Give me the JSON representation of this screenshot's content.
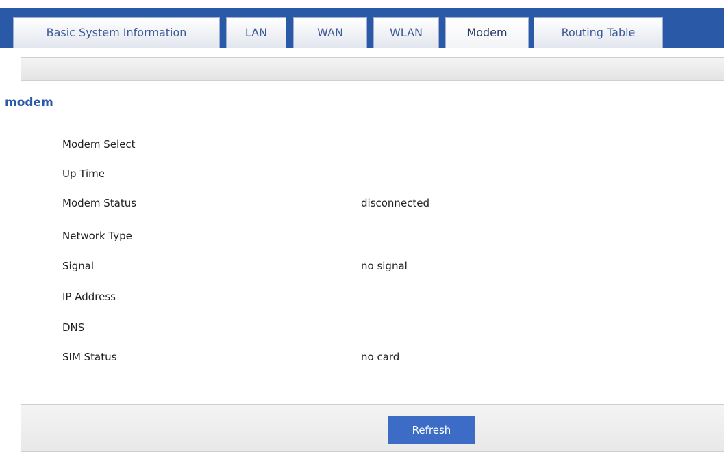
{
  "tabs": [
    {
      "label": "Basic System Information",
      "active": false
    },
    {
      "label": "LAN",
      "active": false
    },
    {
      "label": "WAN",
      "active": false
    },
    {
      "label": "WLAN",
      "active": false
    },
    {
      "label": "Modem",
      "active": true
    },
    {
      "label": "Routing Table",
      "active": false
    }
  ],
  "section": {
    "title": "modem",
    "rows": [
      {
        "label": "Modem Select",
        "value": ""
      },
      {
        "label": "Up Time",
        "value": ""
      },
      {
        "label": "Modem Status",
        "value": "disconnected"
      },
      {
        "label": "Network Type",
        "value": ""
      },
      {
        "label": "Signal",
        "value": "no signal"
      },
      {
        "label": "IP Address",
        "value": ""
      },
      {
        "label": "DNS",
        "value": ""
      },
      {
        "label": "SIM Status",
        "value": "no card"
      }
    ]
  },
  "actions": {
    "refresh_label": "Refresh"
  },
  "colors": {
    "header_bar": "#2a59a7",
    "accent_button": "#3c6cc6",
    "section_title": "#2a59a7"
  }
}
